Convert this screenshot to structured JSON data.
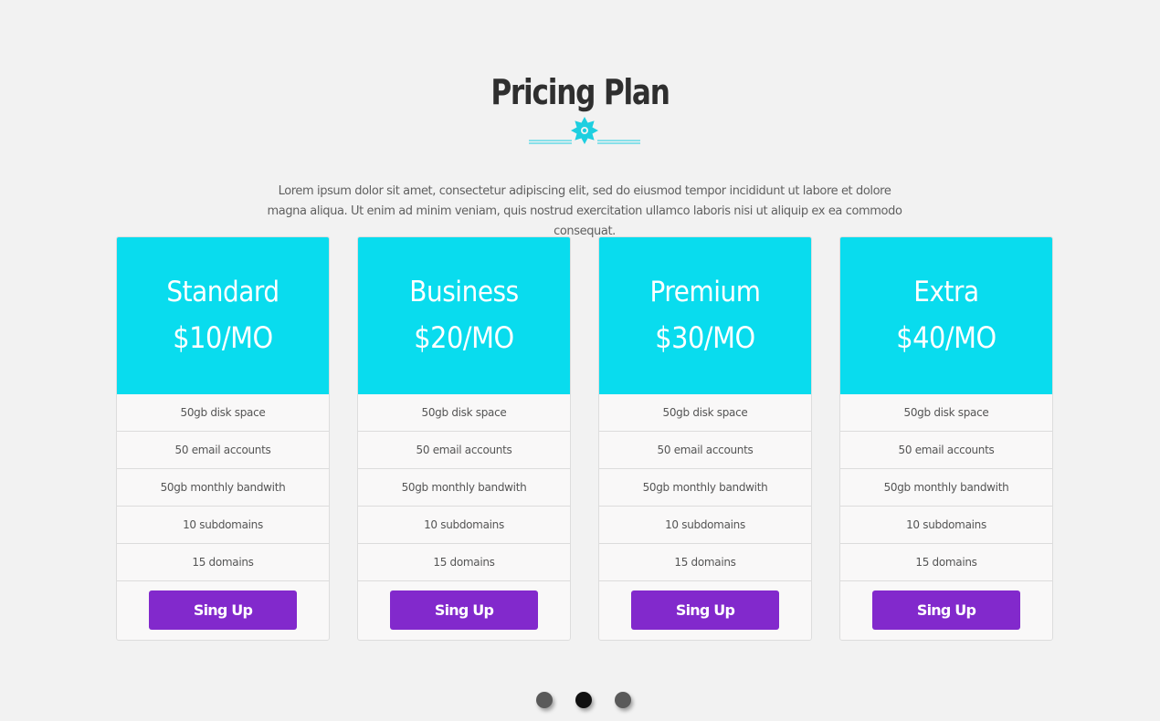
{
  "header": {
    "title": "Pricing Plan",
    "description": "Lorem ipsum dolor sit amet, consectetur adipiscing elit, sed do eiusmod tempor incididunt ut labore et dolore magna aliqua. Ut enim ad minim veniam, quis nostrud exercitation ullamco laboris nisi ut aliquip ex ea commodo consequat."
  },
  "divider": {
    "icon": "star-burst-icon",
    "color": "#1ecfe0"
  },
  "colors": {
    "accent": "#09dcee",
    "button": "#8229cc",
    "background": "#f2f2f2",
    "dot_active": "#111111",
    "dot_inactive": "#5a5a5a"
  },
  "plans": [
    {
      "name": "Standard",
      "price": "$10/MO",
      "features": [
        "50gb disk space",
        "50 email accounts",
        "50gb monthly bandwith",
        "10 subdomains",
        "15 domains"
      ],
      "button_label": "Sing Up"
    },
    {
      "name": "Business",
      "price": "$20/MO",
      "features": [
        "50gb disk space",
        "50 email accounts",
        "50gb monthly bandwith",
        "10 subdomains",
        "15 domains"
      ],
      "button_label": "Sing Up"
    },
    {
      "name": "Premium",
      "price": "$30/MO",
      "features": [
        "50gb disk space",
        "50 email accounts",
        "50gb monthly bandwith",
        "10 subdomains",
        "15 domains"
      ],
      "button_label": "Sing Up"
    },
    {
      "name": "Extra",
      "price": "$40/MO",
      "features": [
        "50gb disk space",
        "50 email accounts",
        "50gb monthly bandwith",
        "10 subdomains",
        "15 domains"
      ],
      "button_label": "Sing Up"
    }
  ],
  "pagination": {
    "total": 3,
    "active_index": 1
  }
}
